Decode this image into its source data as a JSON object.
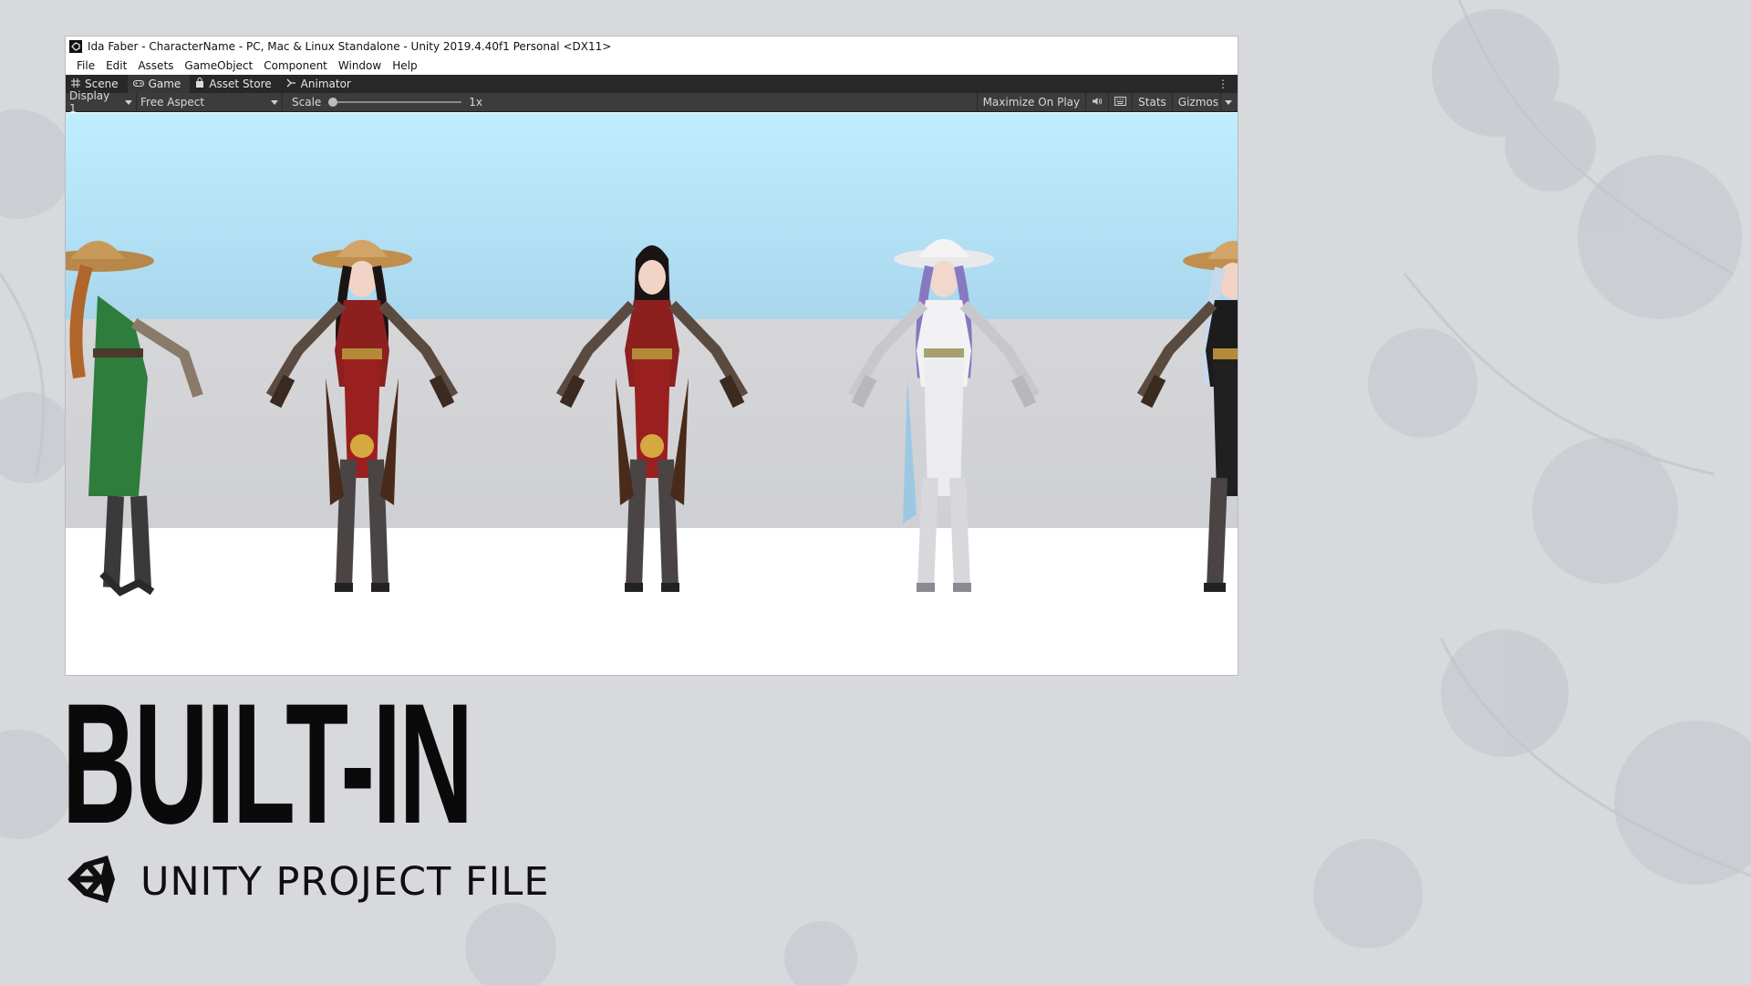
{
  "window": {
    "title": "Ida Faber - CharacterName - PC, Mac & Linux Standalone - Unity 2019.4.40f1 Personal <DX11>"
  },
  "menu": {
    "items": [
      "File",
      "Edit",
      "Assets",
      "GameObject",
      "Component",
      "Window",
      "Help"
    ]
  },
  "tabs": [
    {
      "label": "Scene",
      "icon": "grid-icon"
    },
    {
      "label": "Game",
      "icon": "gamepad-icon"
    },
    {
      "label": "Asset Store",
      "icon": "lock-bag-icon"
    },
    {
      "label": "Animator",
      "icon": "animator-icon"
    }
  ],
  "toolbar": {
    "display": "Display 1",
    "aspect": "Free Aspect",
    "scale_label": "Scale",
    "scale_value": "1x",
    "maximize": "Maximize On Play",
    "stats": "Stats",
    "gizmos": "Gizmos"
  },
  "viewport": {
    "sky_color": "#bfeeff",
    "wall_color": "#d9d9dc",
    "floor_color": "#ffffff",
    "characters": [
      {
        "outfit": "green",
        "hat": "straw"
      },
      {
        "outfit": "red",
        "hat": "straw"
      },
      {
        "outfit": "red",
        "hat": "none"
      },
      {
        "outfit": "white",
        "hat": "white-straw"
      },
      {
        "outfit": "black",
        "hat": "straw"
      }
    ]
  },
  "heading": "BUILT-IN",
  "subheading": "UNITY PROJECT FILE",
  "logo": "unity-logo-icon"
}
